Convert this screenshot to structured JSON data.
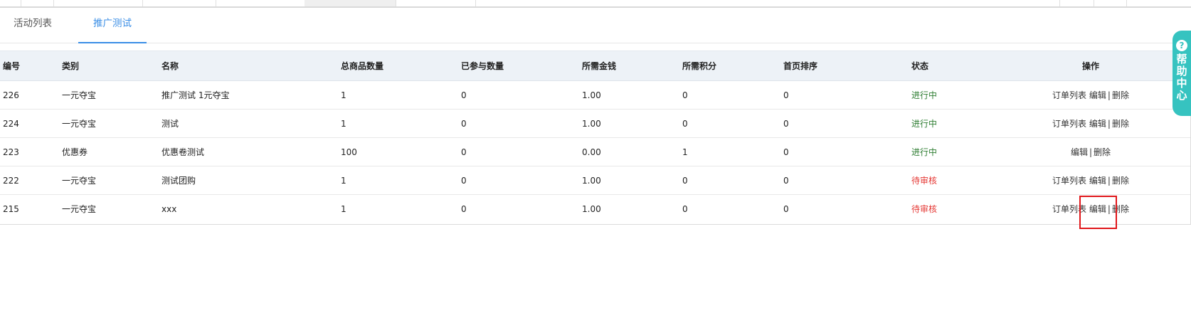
{
  "tabs": [
    {
      "label": "活动列表"
    },
    {
      "label": "推广测试"
    }
  ],
  "table": {
    "headers": [
      "编号",
      "类别",
      "名称",
      "总商品数量",
      "已参与数量",
      "所需金钱",
      "所需积分",
      "首页排序",
      "状态",
      "操作"
    ],
    "rows": [
      {
        "id": "226",
        "category": "一元夺宝",
        "name": "推广测试 1元夺宝",
        "total": "1",
        "joined": "0",
        "money": "1.00",
        "points": "0",
        "sort": "0",
        "status": "进行中"
      },
      {
        "id": "224",
        "category": "一元夺宝",
        "name": "测试",
        "total": "1",
        "joined": "0",
        "money": "1.00",
        "points": "0",
        "sort": "0",
        "status": "进行中"
      },
      {
        "id": "223",
        "category": "优惠券",
        "name": "优惠卷测试",
        "total": "100",
        "joined": "0",
        "money": "0.00",
        "points": "1",
        "sort": "0",
        "status": "进行中"
      },
      {
        "id": "222",
        "category": "一元夺宝",
        "name": "测试团购",
        "total": "1",
        "joined": "0",
        "money": "1.00",
        "points": "0",
        "sort": "0",
        "status": "待审核"
      },
      {
        "id": "215",
        "category": "一元夺宝",
        "name": "xxx",
        "total": "1",
        "joined": "0",
        "money": "1.00",
        "points": "0",
        "sort": "0",
        "status": "待审核"
      }
    ],
    "actions": {
      "orders": "订单列表",
      "edit": "编辑",
      "delete": "删除",
      "separator": "|"
    }
  },
  "colors": {
    "accent": "#3a8ee6",
    "status_active": "#2e7d32",
    "status_pending": "#e53935",
    "help_bg": "#36c3c0",
    "highlight": "#e0161a"
  },
  "help": {
    "icon": "question-icon",
    "question_mark": "?",
    "label": [
      "帮",
      "助",
      "中",
      "心"
    ]
  }
}
